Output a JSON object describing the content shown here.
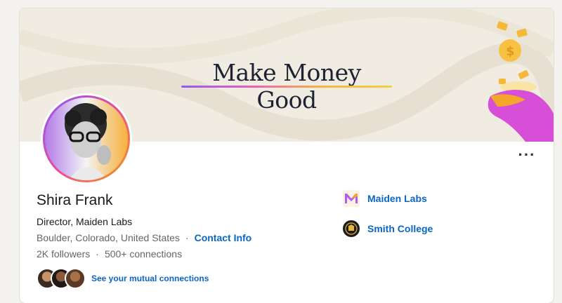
{
  "banner": {
    "title": "Make Money Good"
  },
  "profile": {
    "name": "Shira Frank",
    "headline": "Director, Maiden Labs",
    "location": "Boulder, Colorado, United States",
    "separator": "·",
    "contact_label": "Contact Info",
    "followers": "2K followers",
    "connections": "500+ connections",
    "mutual_label": "See your mutual connections"
  },
  "experience": [
    {
      "name": "Maiden Labs",
      "icon": "maiden-labs-logo"
    },
    {
      "name": "Smith College",
      "icon": "smith-college-logo"
    }
  ],
  "actions": {
    "more_label": "···"
  },
  "colors": {
    "link": "#0a66c2",
    "accent_gradient": [
      "#8e5cf0",
      "#e95fb8",
      "#f5b640"
    ]
  }
}
